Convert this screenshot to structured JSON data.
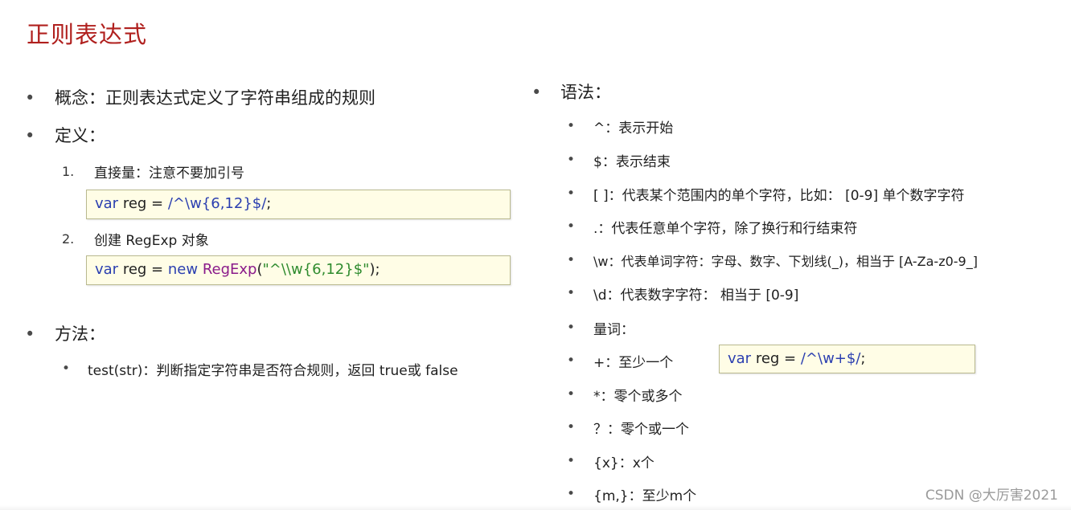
{
  "title": "正则表达式",
  "left": {
    "concept": "概念：正则表达式定义了字符串组成的规则",
    "definition": "定义：",
    "def_items": [
      {
        "num": "1.",
        "label": "直接量：注意不要加引号"
      },
      {
        "num": "2.",
        "label": "创建 RegExp 对象"
      }
    ],
    "code1": {
      "kw": "var",
      "rest": " reg = ",
      "regex": "/^\\w{6,12}$/",
      "end": ";"
    },
    "code2": {
      "kw": "var",
      "mid": " reg = ",
      "kw2": "new",
      "space": " ",
      "obj": "RegExp",
      "paren": "(",
      "str": "\"^\\\\w{6,12}$\"",
      "end": ");"
    },
    "methods": "方法：",
    "method_items": [
      "test(str)：判断指定字符串是否符合规则，返回 true或 false"
    ]
  },
  "right": {
    "syntax": "语法：",
    "items": [
      "^：表示开始",
      "$：表示结束",
      "[ ]：代表某个范围内的单个字符，比如： [0-9] 单个数字字符",
      ".：代表任意单个字符，除了换行和行结束符",
      "\\w：代表单词字符：字母、数字、下划线(_)，相当于 [A-Za-z0-9_]",
      "\\d：代表数字字符： 相当于 [0-9]",
      "量词：",
      "+：至少一个",
      "*：零个或多个",
      "？：零个或一个",
      "{x}：x个",
      "{m,}：至少m个"
    ],
    "code3": {
      "kw": "var",
      "rest": " reg = ",
      "regex": "/^\\w+$/",
      "end": ";"
    }
  },
  "bullet_char": "•",
  "watermark": "CSDN @大厉害2021",
  "colors": {
    "title": "#b0201e",
    "code_bg": "#fffde6",
    "keyword": "#2b3fb0",
    "object": "#8a1a8a",
    "string": "#2e8b2e"
  }
}
